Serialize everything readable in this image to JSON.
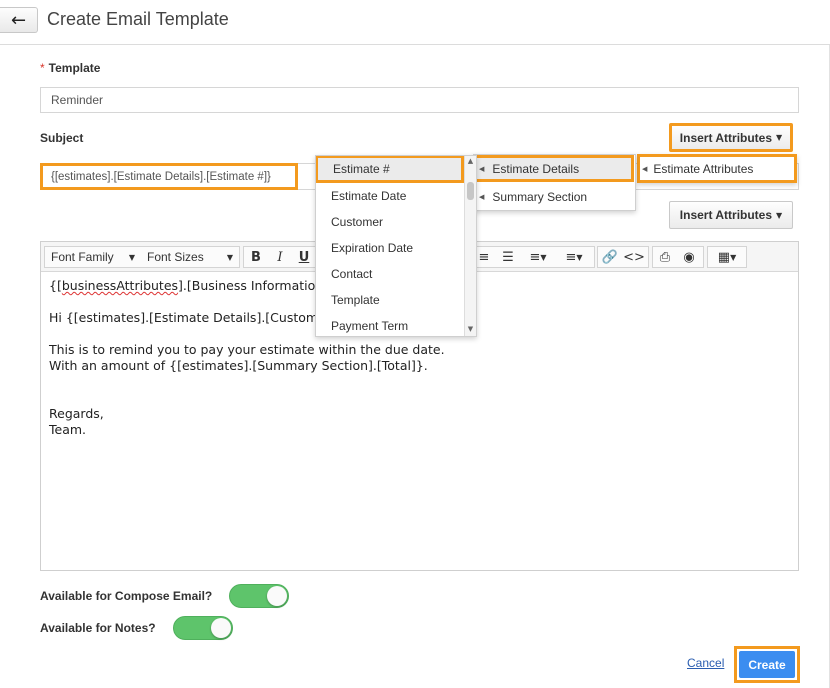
{
  "header": {
    "back_icon": "arrow-left-icon",
    "title": "Create Email Template"
  },
  "template": {
    "label": "Template",
    "required_mark": "*",
    "value": "Reminder"
  },
  "subject": {
    "label": "Subject",
    "value": "{[estimates].[Estimate Details].[Estimate #]}",
    "insert_attributes_label": "Insert Attributes"
  },
  "body_insert_attributes_label": "Insert Attributes",
  "menus": {
    "level1": [
      {
        "label": "Estimate Attributes"
      }
    ],
    "level2": [
      {
        "label": "Estimate Details"
      },
      {
        "label": "Summary Section"
      }
    ],
    "level3": [
      {
        "label": "Estimate #"
      },
      {
        "label": "Estimate Date"
      },
      {
        "label": "Customer"
      },
      {
        "label": "Expiration Date"
      },
      {
        "label": "Contact"
      },
      {
        "label": "Template"
      },
      {
        "label": "Payment Term"
      }
    ]
  },
  "toolbar": {
    "font_family": "Font Family",
    "font_sizes": "Font Sizes",
    "bold": "B",
    "italic": "I",
    "underline": "U"
  },
  "editor": {
    "line1_a": "{[",
    "line1_b": "businessAttributes",
    "line1_c": "].[Business Information]",
    "line2": "Hi {[estimates].[Estimate Details].[Custome",
    "line3": "This is to remind you to pay your estimate within the due date.",
    "line4": "With an amount of {[estimates].[Summary Section].[Total]}.",
    "line5": "Regards,",
    "line6": "Team."
  },
  "toggles": {
    "compose": {
      "label": "Available for Compose Email?",
      "on": true
    },
    "notes": {
      "label": "Available for Notes?",
      "on": true
    }
  },
  "actions": {
    "cancel": "Cancel",
    "create": "Create"
  },
  "colors": {
    "highlight": "#f39a1e",
    "toggle_on": "#5ec46b",
    "primary": "#3b8df0"
  }
}
